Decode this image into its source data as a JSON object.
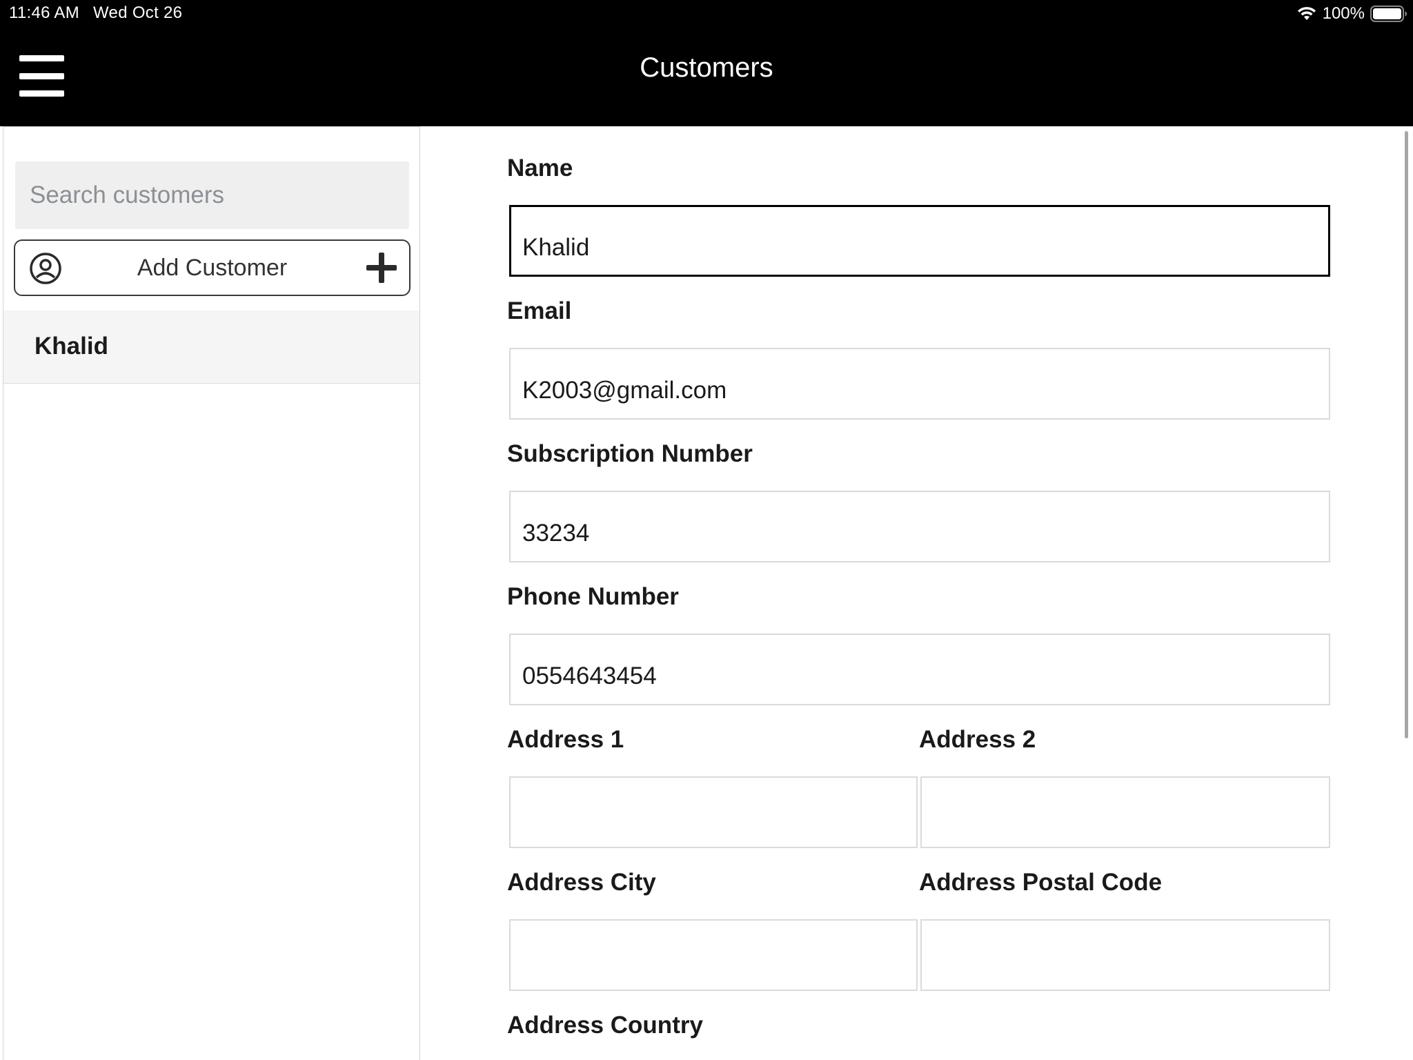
{
  "status_bar": {
    "time": "11:46 AM",
    "date": "Wed Oct 26",
    "battery": "100%"
  },
  "nav": {
    "title": "Customers"
  },
  "sidebar": {
    "search_placeholder": "Search customers",
    "add_customer_label": "Add Customer",
    "customers": [
      {
        "name": "Khalid"
      }
    ]
  },
  "form": {
    "name": {
      "label": "Name",
      "value": "Khalid"
    },
    "email": {
      "label": "Email",
      "value": "K2003@gmail.com"
    },
    "subscription": {
      "label": "Subscription Number",
      "value": "33234"
    },
    "phone": {
      "label": "Phone Number",
      "value": "0554643454"
    },
    "address1": {
      "label": "Address 1",
      "value": ""
    },
    "address2": {
      "label": "Address 2",
      "value": ""
    },
    "city": {
      "label": "Address City",
      "value": ""
    },
    "postal": {
      "label": "Address Postal Code",
      "value": ""
    },
    "country": {
      "label": "Address Country"
    }
  }
}
